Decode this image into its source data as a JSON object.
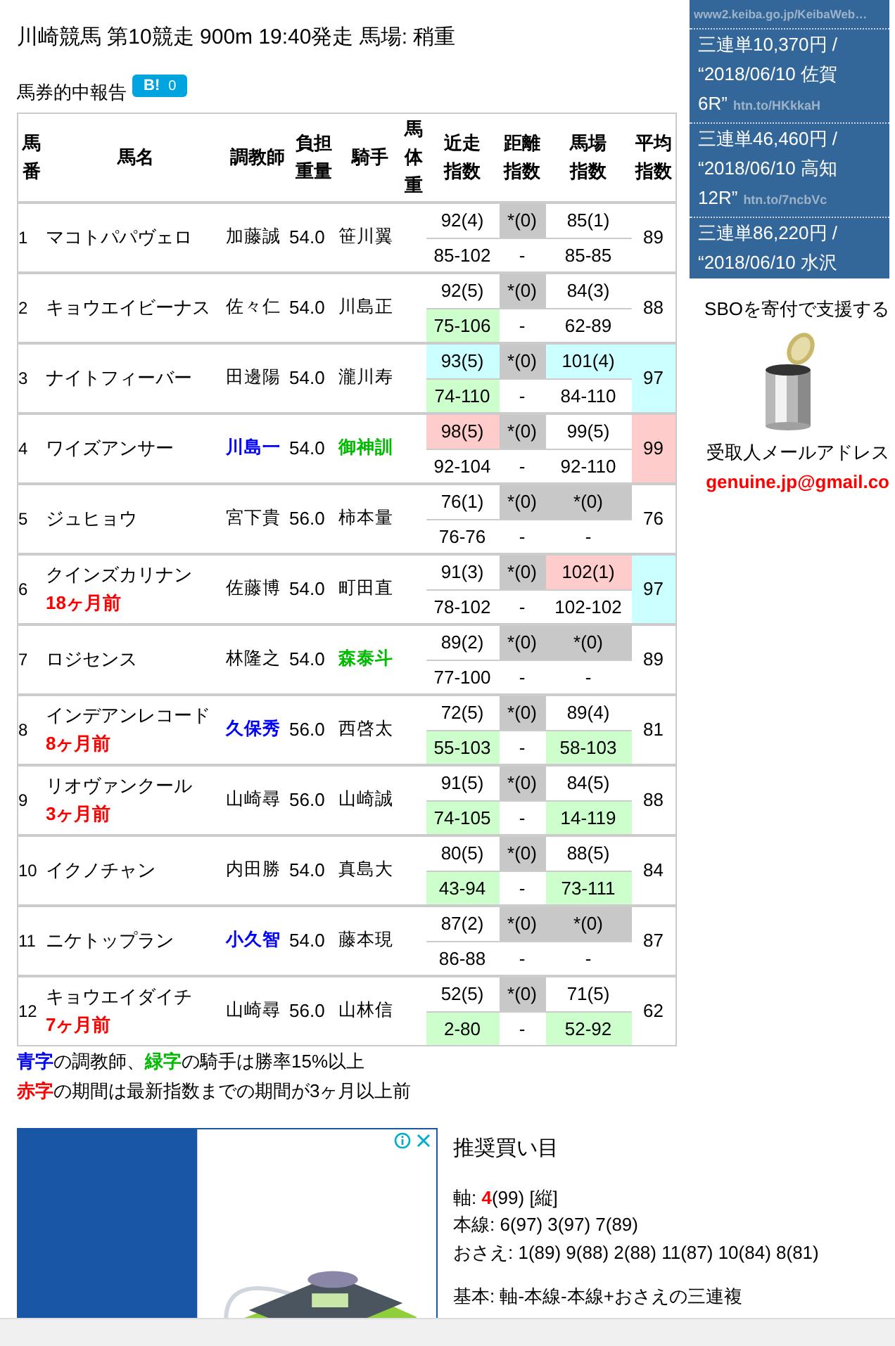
{
  "title": "川崎競馬 第10競走 900m 19:40発走 馬場: 稍重",
  "report": {
    "label": "馬券的中報告",
    "button": "B!",
    "count": "0"
  },
  "table": {
    "columns": [
      "馬番",
      "馬名",
      "調教師",
      "負担重量",
      "騎手",
      "馬体重",
      "近走指数",
      "距離指数",
      "馬場指数",
      "平均指数"
    ],
    "rows": [
      {
        "no": "1",
        "name": "マコトパパヴェロ",
        "trainer": {
          "text": "加藤誠"
        },
        "weight": "54.0",
        "jockey": {
          "text": "笹川翼"
        },
        "recent": [
          {
            "text": "92(4)"
          },
          {
            "text": "85-102"
          }
        ],
        "distance": [
          {
            "text": "*(0)",
            "color": "#c8c8c8"
          },
          {
            "text": "-"
          }
        ],
        "track": [
          {
            "text": "85(1)"
          },
          {
            "text": "85-85"
          }
        ],
        "average": {
          "text": "89"
        }
      },
      {
        "no": "2",
        "name": "キョウエイビーナス",
        "trainer": {
          "text": "佐々仁"
        },
        "weight": "54.0",
        "jockey": {
          "text": "川島正"
        },
        "recent": [
          {
            "text": "92(5)"
          },
          {
            "text": "75-106",
            "color": "#ccffcc"
          }
        ],
        "distance": [
          {
            "text": "*(0)",
            "color": "#c8c8c8"
          },
          {
            "text": "-"
          }
        ],
        "track": [
          {
            "text": "84(3)"
          },
          {
            "text": "62-89"
          }
        ],
        "average": {
          "text": "88"
        }
      },
      {
        "no": "3",
        "name": "ナイトフィーバー",
        "trainer": {
          "text": "田邊陽"
        },
        "weight": "54.0",
        "jockey": {
          "text": "瀧川寿"
        },
        "recent": [
          {
            "text": "93(5)",
            "color": "#ccffff"
          },
          {
            "text": "74-110",
            "color": "#ccffcc"
          }
        ],
        "distance": [
          {
            "text": "*(0)",
            "color": "#c8c8c8"
          },
          {
            "text": "-"
          }
        ],
        "track": [
          {
            "text": "101(4)",
            "color": "#ccffff"
          },
          {
            "text": "84-110"
          }
        ],
        "average": {
          "text": "97",
          "color": "#ccffff"
        }
      },
      {
        "no": "4",
        "name": "ワイズアンサー",
        "trainer": {
          "text": "川島一",
          "color": "#0000ff"
        },
        "weight": "54.0",
        "jockey": {
          "text": "御神訓",
          "color": "#00bb00"
        },
        "recent": [
          {
            "text": "98(5)",
            "color": "#ffcccc"
          },
          {
            "text": "92-104"
          }
        ],
        "distance": [
          {
            "text": "*(0)",
            "color": "#c8c8c8"
          },
          {
            "text": "-"
          }
        ],
        "track": [
          {
            "text": "99(5)"
          },
          {
            "text": "92-110"
          }
        ],
        "average": {
          "text": "99",
          "color": "#ffcccc"
        }
      },
      {
        "no": "5",
        "name": "ジュヒョウ",
        "trainer": {
          "text": "宮下貴"
        },
        "weight": "56.0",
        "jockey": {
          "text": "柿本量"
        },
        "recent": [
          {
            "text": "76(1)"
          },
          {
            "text": "76-76"
          }
        ],
        "distance": [
          {
            "text": "*(0)",
            "color": "#c8c8c8"
          },
          {
            "text": "-"
          }
        ],
        "track": [
          {
            "text": "*(0)",
            "color": "#c8c8c8"
          },
          {
            "text": "-"
          }
        ],
        "average": {
          "text": "76"
        }
      },
      {
        "no": "6",
        "name": "クインズカリナン",
        "note": "18ヶ月前",
        "trainer": {
          "text": "佐藤博"
        },
        "weight": "54.0",
        "jockey": {
          "text": "町田直"
        },
        "recent": [
          {
            "text": "91(3)"
          },
          {
            "text": "78-102"
          }
        ],
        "distance": [
          {
            "text": "*(0)",
            "color": "#c8c8c8"
          },
          {
            "text": "-"
          }
        ],
        "track": [
          {
            "text": "102(1)",
            "color": "#ffcccc"
          },
          {
            "text": "102-102"
          }
        ],
        "average": {
          "text": "97",
          "color": "#ccffff"
        }
      },
      {
        "no": "7",
        "name": "ロジセンス",
        "trainer": {
          "text": "林隆之"
        },
        "weight": "54.0",
        "jockey": {
          "text": "森泰斗",
          "color": "#00bb00"
        },
        "recent": [
          {
            "text": "89(2)"
          },
          {
            "text": "77-100"
          }
        ],
        "distance": [
          {
            "text": "*(0)",
            "color": "#c8c8c8"
          },
          {
            "text": "-"
          }
        ],
        "track": [
          {
            "text": "*(0)",
            "color": "#c8c8c8"
          },
          {
            "text": "-"
          }
        ],
        "average": {
          "text": "89"
        }
      },
      {
        "no": "8",
        "name": "インデアンレコード",
        "note": "8ヶ月前",
        "trainer": {
          "text": "久保秀",
          "color": "#0000ff"
        },
        "weight": "56.0",
        "jockey": {
          "text": "西啓太"
        },
        "recent": [
          {
            "text": "72(5)"
          },
          {
            "text": "55-103",
            "color": "#ccffcc"
          }
        ],
        "distance": [
          {
            "text": "*(0)",
            "color": "#c8c8c8"
          },
          {
            "text": "-"
          }
        ],
        "track": [
          {
            "text": "89(4)"
          },
          {
            "text": "58-103",
            "color": "#ccffcc"
          }
        ],
        "average": {
          "text": "81"
        }
      },
      {
        "no": "9",
        "name": "リオヴァンクール",
        "note": "3ヶ月前",
        "trainer": {
          "text": "山崎尋"
        },
        "weight": "56.0",
        "jockey": {
          "text": "山崎誠"
        },
        "recent": [
          {
            "text": "91(5)"
          },
          {
            "text": "74-105",
            "color": "#ccffcc"
          }
        ],
        "distance": [
          {
            "text": "*(0)",
            "color": "#c8c8c8"
          },
          {
            "text": "-"
          }
        ],
        "track": [
          {
            "text": "84(5)"
          },
          {
            "text": "14-119",
            "color": "#ccffcc"
          }
        ],
        "average": {
          "text": "88"
        }
      },
      {
        "no": "10",
        "name": "イクノチャン",
        "trainer": {
          "text": "内田勝"
        },
        "weight": "54.0",
        "jockey": {
          "text": "真島大"
        },
        "recent": [
          {
            "text": "80(5)"
          },
          {
            "text": "43-94",
            "color": "#ccffcc"
          }
        ],
        "distance": [
          {
            "text": "*(0)",
            "color": "#c8c8c8"
          },
          {
            "text": "-"
          }
        ],
        "track": [
          {
            "text": "88(5)"
          },
          {
            "text": "73-111",
            "color": "#ccffcc"
          }
        ],
        "average": {
          "text": "84"
        }
      },
      {
        "no": "11",
        "name": "ニケトップラン",
        "trainer": {
          "text": "小久智",
          "color": "#0000ff"
        },
        "weight": "54.0",
        "jockey": {
          "text": "藤本現"
        },
        "recent": [
          {
            "text": "87(2)"
          },
          {
            "text": "86-88"
          }
        ],
        "distance": [
          {
            "text": "*(0)",
            "color": "#c8c8c8"
          },
          {
            "text": "-"
          }
        ],
        "track": [
          {
            "text": "*(0)",
            "color": "#c8c8c8"
          },
          {
            "text": "-"
          }
        ],
        "average": {
          "text": "87"
        }
      },
      {
        "no": "12",
        "name": "キョウエイダイチ",
        "note": "7ヶ月前",
        "trainer": {
          "text": "山崎尋"
        },
        "weight": "56.0",
        "jockey": {
          "text": "山林信"
        },
        "recent": [
          {
            "text": "52(5)"
          },
          {
            "text": "2-80",
            "color": "#ccffcc"
          }
        ],
        "distance": [
          {
            "text": "*(0)",
            "color": "#c8c8c8"
          },
          {
            "text": "-"
          }
        ],
        "track": [
          {
            "text": "71(5)"
          },
          {
            "text": "52-92",
            "color": "#ccffcc"
          }
        ],
        "average": {
          "text": "62"
        }
      }
    ]
  },
  "legend": [
    [
      {
        "text": "青字",
        "color": "#0000ff"
      },
      {
        "text": "の調教師、"
      },
      {
        "text": "緑字",
        "color": "#00bb00"
      },
      {
        "text": "の騎手は勝率15%以上"
      }
    ],
    [
      {
        "text": "赤字",
        "color": "#ff0000"
      },
      {
        "text": "の期間は最新指数までの期間が3ヶ月以上前"
      }
    ]
  ],
  "ad": {
    "kind": "picture"
  },
  "recommend": {
    "title": "推奨買い目",
    "lines": [
      [
        {
          "text": "軸: "
        },
        {
          "text": "4",
          "color": "#ff0000"
        },
        {
          "text": "(99) [縦]"
        }
      ],
      [
        {
          "text": "本線: 6(97) 3(97) 7(89)"
        }
      ],
      [
        {
          "text": "おさえ: 1(89) 9(88) 2(88) 11(87) 10(84) 8(81)"
        }
      ]
    ],
    "basis": [
      {
        "text": "基本: 軸-本線-本線+おさえの三連複"
      }
    ]
  },
  "sidebar": {
    "items": [
      {
        "link": "www2.keiba.go.jp/KeibaWeb…"
      },
      {
        "title": "三連単10,370円 / “2018/06/10 佐賀 6R”",
        "link": "htn.to/HKkkaH"
      },
      {
        "title": "三連単46,460円 / “2018/06/10 高知 12R”",
        "link": "htn.to/7ncbVc"
      },
      {
        "title": "三連単86,220円 / “2018/06/10 水沢"
      }
    ],
    "donate": "SBOを寄付で支援する",
    "can": {
      "kind": "picture"
    },
    "mail_label": "受取人メールアドレス",
    "mail": "genuine.jp@gmail.co"
  }
}
